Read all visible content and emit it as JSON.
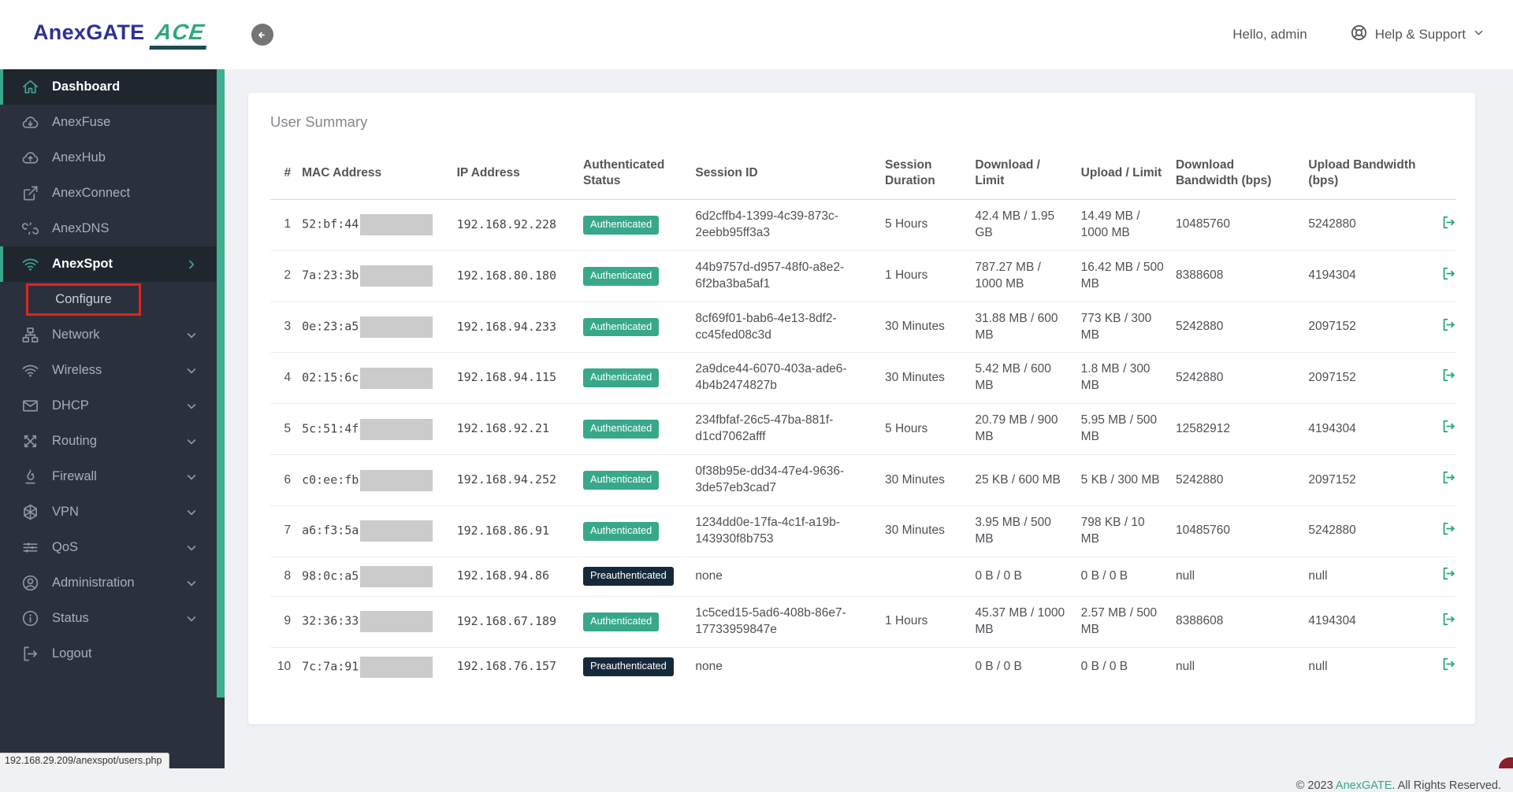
{
  "header": {
    "logo_brand": "AnexGATE",
    "logo_product": "ACE",
    "back_icon": "back-arrow-icon",
    "greeting": "Hello, admin",
    "help_label": "Help & Support",
    "help_icon": "life-ring-icon",
    "help_chevron_icon": "chevron-down-icon"
  },
  "sidebar": {
    "items": [
      {
        "label": "Dashboard",
        "icon": "home",
        "active": true,
        "chevron": null,
        "submenu": false,
        "highlighted": false
      },
      {
        "label": "AnexFuse",
        "icon": "cloud-download",
        "active": false,
        "chevron": null,
        "submenu": false,
        "highlighted": false
      },
      {
        "label": "AnexHub",
        "icon": "cloud-upload",
        "active": false,
        "chevron": null,
        "submenu": false,
        "highlighted": false
      },
      {
        "label": "AnexConnect",
        "icon": "external-link",
        "active": false,
        "chevron": null,
        "submenu": false,
        "highlighted": false
      },
      {
        "label": "AnexDNS",
        "icon": "broken-link",
        "active": false,
        "chevron": null,
        "submenu": false,
        "highlighted": false
      },
      {
        "label": "AnexSpot",
        "icon": "wifi",
        "active": true,
        "chevron": "right",
        "submenu": false,
        "highlighted": false
      },
      {
        "label": "Configure",
        "icon": null,
        "active": false,
        "chevron": null,
        "submenu": true,
        "highlighted": true
      },
      {
        "label": "Network",
        "icon": "sitemap",
        "active": false,
        "chevron": "down",
        "submenu": false,
        "highlighted": false
      },
      {
        "label": "Wireless",
        "icon": "wifi",
        "active": false,
        "chevron": "down",
        "submenu": false,
        "highlighted": false
      },
      {
        "label": "DHCP",
        "icon": "envelope",
        "active": false,
        "chevron": "down",
        "submenu": false,
        "highlighted": false
      },
      {
        "label": "Routing",
        "icon": "arrows",
        "active": false,
        "chevron": "down",
        "submenu": false,
        "highlighted": false
      },
      {
        "label": "Firewall",
        "icon": "fire",
        "active": false,
        "chevron": "down",
        "submenu": false,
        "highlighted": false
      },
      {
        "label": "VPN",
        "icon": "hexagon",
        "active": false,
        "chevron": "down",
        "submenu": false,
        "highlighted": false
      },
      {
        "label": "QoS",
        "icon": "sliders",
        "active": false,
        "chevron": "down",
        "submenu": false,
        "highlighted": false
      },
      {
        "label": "Administration",
        "icon": "user-circle",
        "active": false,
        "chevron": "down",
        "submenu": false,
        "highlighted": false
      },
      {
        "label": "Status",
        "icon": "info-circle",
        "active": false,
        "chevron": "down",
        "submenu": false,
        "highlighted": false
      },
      {
        "label": "Logout",
        "icon": "sign-out",
        "active": false,
        "chevron": null,
        "submenu": false,
        "highlighted": false
      }
    ]
  },
  "main": {
    "card_title": "User Summary",
    "table": {
      "columns": [
        "#",
        "MAC Address",
        "IP Address",
        "Authenticated Status",
        "Session ID",
        "Session Duration",
        "Download / Limit",
        "Upload / Limit",
        "Download Bandwidth (bps)",
        "Upload Bandwidth (bps)",
        ""
      ],
      "row_action_icon": "sign-out-icon",
      "rows": [
        {
          "num": "1",
          "mac": "52:bf:44",
          "ip": "192.168.92.228",
          "status": "Authenticated",
          "session_id": "6d2cffb4-1399-4c39-873c-2eebb95ff3a3",
          "duration": "5 Hours",
          "download": "42.4 MB / 1.95 GB",
          "upload": "14.49 MB / 1000 MB",
          "download_bw": "10485760",
          "upload_bw": "5242880"
        },
        {
          "num": "2",
          "mac": "7a:23:3b",
          "ip": "192.168.80.180",
          "status": "Authenticated",
          "session_id": "44b9757d-d957-48f0-a8e2-6f2ba3ba5af1",
          "duration": "1 Hours",
          "download": "787.27 MB / 1000 MB",
          "upload": "16.42 MB / 500 MB",
          "download_bw": "8388608",
          "upload_bw": "4194304"
        },
        {
          "num": "3",
          "mac": "0e:23:a5",
          "ip": "192.168.94.233",
          "status": "Authenticated",
          "session_id": "8cf69f01-bab6-4e13-8df2-cc45fed08c3d",
          "duration": "30 Minutes",
          "download": "31.88 MB / 600 MB",
          "upload": "773 KB / 300 MB",
          "download_bw": "5242880",
          "upload_bw": "2097152"
        },
        {
          "num": "4",
          "mac": "02:15:6c",
          "ip": "192.168.94.115",
          "status": "Authenticated",
          "session_id": "2a9dce44-6070-403a-ade6-4b4b2474827b",
          "duration": "30 Minutes",
          "download": "5.42 MB / 600 MB",
          "upload": "1.8 MB / 300 MB",
          "download_bw": "5242880",
          "upload_bw": "2097152"
        },
        {
          "num": "5",
          "mac": "5c:51:4f",
          "ip": "192.168.92.21",
          "status": "Authenticated",
          "session_id": "234fbfaf-26c5-47ba-881f-d1cd7062afff",
          "duration": "5 Hours",
          "download": "20.79 MB / 900 MB",
          "upload": "5.95 MB / 500 MB",
          "download_bw": "12582912",
          "upload_bw": "4194304"
        },
        {
          "num": "6",
          "mac": "c0:ee:fb",
          "ip": "192.168.94.252",
          "status": "Authenticated",
          "session_id": "0f38b95e-dd34-47e4-9636-3de57eb3cad7",
          "duration": "30 Minutes",
          "download": "25 KB / 600 MB",
          "upload": "5 KB / 300 MB",
          "download_bw": "5242880",
          "upload_bw": "2097152"
        },
        {
          "num": "7",
          "mac": "a6:f3:5a",
          "ip": "192.168.86.91",
          "status": "Authenticated",
          "session_id": "1234dd0e-17fa-4c1f-a19b-143930f8b753",
          "duration": "30 Minutes",
          "download": "3.95 MB / 500 MB",
          "upload": "798 KB / 10 MB",
          "download_bw": "10485760",
          "upload_bw": "5242880"
        },
        {
          "num": "8",
          "mac": "98:0c:a5",
          "ip": "192.168.94.86",
          "status": "Preauthenticated",
          "session_id": "none",
          "duration": "",
          "download": "0 B / 0 B",
          "upload": "0 B / 0 B",
          "download_bw": "null",
          "upload_bw": "null"
        },
        {
          "num": "9",
          "mac": "32:36:33",
          "ip": "192.168.67.189",
          "status": "Authenticated",
          "session_id": "1c5ced15-5ad6-408b-86e7-17733959847e",
          "duration": "1 Hours",
          "download": "45.37 MB / 1000 MB",
          "upload": "2.57 MB / 500 MB",
          "download_bw": "8388608",
          "upload_bw": "4194304"
        },
        {
          "num": "10",
          "mac": "7c:7a:91",
          "ip": "192.168.76.157",
          "status": "Preauthenticated",
          "session_id": "none",
          "duration": "",
          "download": "0 B / 0 B",
          "upload": "0 B / 0 B",
          "download_bw": "null",
          "upload_bw": "null"
        }
      ]
    }
  },
  "footer": {
    "prefix": "© 2023 ",
    "brand": "AnexGATE",
    "suffix": ". All Rights Reserved."
  },
  "statusbar": {
    "url": "192.168.29.209/anexspot/users.php"
  },
  "colors": {
    "accent_green": "#3aa98a",
    "badge_authenticated": "#38a88b",
    "badge_preauthenticated": "#16293a",
    "highlight_red": "#e02424",
    "logo_navy": "#2e3192",
    "logo_green": "#2fa87c",
    "corner_maroon": "#8b1e2e"
  }
}
